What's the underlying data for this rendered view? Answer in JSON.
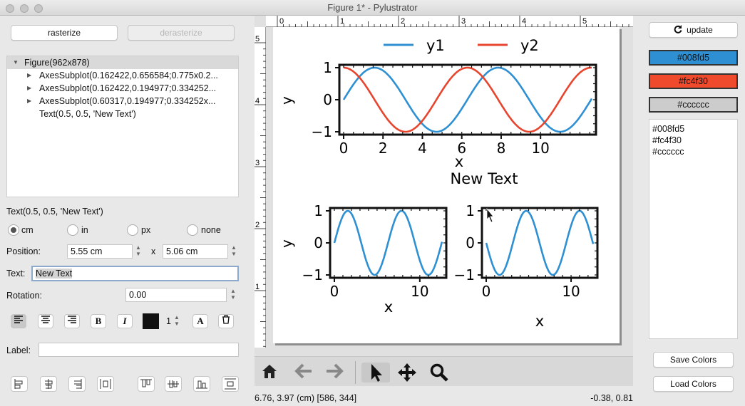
{
  "window": {
    "title": "Figure 1* - Pylustrator"
  },
  "left_panel": {
    "rasterize_label": "rasterize",
    "derasterize_label": "derasterize",
    "tree": [
      {
        "label": "Figure(962x878)",
        "expanded": true
      },
      {
        "label": "AxesSubplot(0.162422,0.656584;0.775x0.2...",
        "expanded": false
      },
      {
        "label": "AxesSubplot(0.162422,0.194977;0.334252...",
        "expanded": false
      },
      {
        "label": "AxesSubplot(0.60317,0.194977;0.334252x...",
        "expanded": false
      },
      {
        "label": "Text(0.5, 0.5, 'New Text')",
        "expanded": null
      }
    ],
    "selected_title": "Text(0.5, 0.5, 'New Text')",
    "units": [
      {
        "label": "cm",
        "selected": true
      },
      {
        "label": "in",
        "selected": false
      },
      {
        "label": "px",
        "selected": false
      },
      {
        "label": "none",
        "selected": false
      }
    ],
    "position_label": "Position:",
    "position_x": "5.55 cm",
    "position_sep": "x",
    "position_y": "5.06 cm",
    "text_label": "Text:",
    "text_value": "New Text",
    "rotation_label": "Rotation:",
    "rotation_value": "0.00",
    "bold_label": "B",
    "italic_label": "I",
    "font_size": "1",
    "font_color": "#111111",
    "label_label": "Label:",
    "label_value": ""
  },
  "figure": {
    "legend": [
      {
        "name": "y1",
        "color": "#2e90d3"
      },
      {
        "name": "y2",
        "color": "#e8452f"
      }
    ],
    "new_text": "New Text",
    "top_axes": {
      "ylabel": "y",
      "xlabel": "x",
      "xticks": [
        "0",
        "2",
        "4",
        "6",
        "8",
        "10"
      ],
      "yticks": [
        "1",
        "0",
        "−1"
      ]
    },
    "bottom_left_axes": {
      "ylabel": "y",
      "xlabel": "x",
      "xticks": [
        "0",
        "10"
      ],
      "yticks": [
        "1",
        "0",
        "−1"
      ]
    },
    "bottom_right_axes": {
      "xlabel": "x",
      "xticks": [
        "0",
        "10"
      ],
      "yticks": [
        "1",
        "0",
        "−1"
      ]
    },
    "ruler_top_labels": [
      "0",
      "1",
      "2",
      "3",
      "4",
      "5"
    ],
    "ruler_left_labels": [
      "5",
      "4",
      "3",
      "2",
      "1"
    ]
  },
  "toolbar": {
    "icons": [
      "home-icon",
      "back-arrow-icon",
      "forward-arrow-icon",
      "pointer-icon",
      "move-icon",
      "zoom-icon"
    ]
  },
  "status": {
    "left": "6.76, 3.97 (cm) [586, 344]",
    "right": "-0.38, 0.81"
  },
  "right_panel": {
    "update_label": "update",
    "colors": [
      {
        "label": "#008fd5",
        "bg": "#2e90d3",
        "fg": "#111111"
      },
      {
        "label": "#fc4f30",
        "bg": "#f04a2c",
        "fg": "#111111"
      },
      {
        "label": "#cccccc",
        "bg": "#cccccc",
        "fg": "#111111"
      }
    ],
    "color_list": [
      "#008fd5",
      "#fc4f30",
      "#cccccc"
    ],
    "save_colors_label": "Save Colors",
    "load_colors_label": "Load Colors"
  }
}
